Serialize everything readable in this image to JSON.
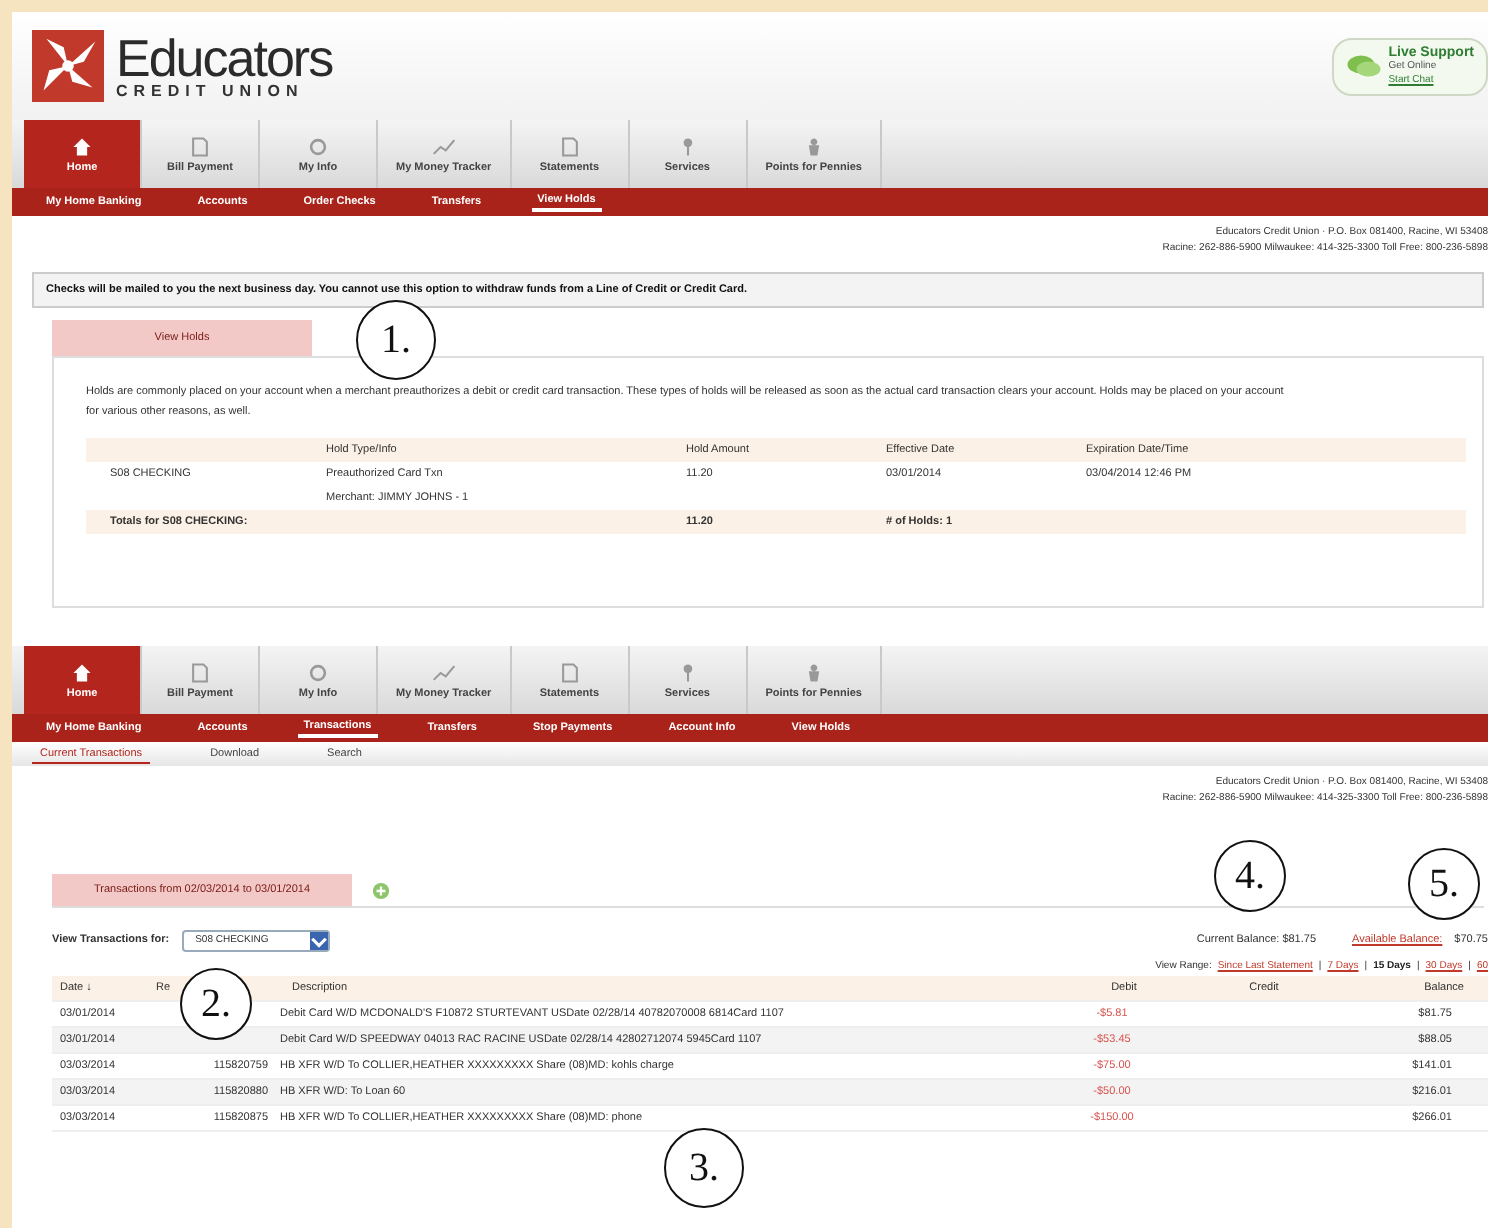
{
  "header": {
    "logo_name": "Educators",
    "logo_sub": "CREDIT UNION",
    "support_title": "Live Support",
    "support_sub": "Get Online",
    "support_link": "Start Chat"
  },
  "top": {
    "tabs": [
      {
        "label": "Home",
        "selected": true
      },
      {
        "label": "Bill Payment",
        "selected": false
      },
      {
        "label": "My Info",
        "selected": false
      },
      {
        "label": "My Money Tracker",
        "selected": false
      },
      {
        "label": "Statements",
        "selected": false
      },
      {
        "label": "Services",
        "selected": false
      },
      {
        "label": "Points for Pennies",
        "selected": false
      }
    ],
    "subnav": [
      {
        "label": "My Home Banking",
        "selected": false
      },
      {
        "label": "Accounts",
        "selected": false
      },
      {
        "label": "Order Checks",
        "selected": false
      },
      {
        "label": "Transfers",
        "selected": false
      },
      {
        "label": "View Holds",
        "selected": true
      }
    ],
    "address": [
      "Educators Credit Union · P.O. Box 081400, Racine, WI 53408",
      "Racine: 262-886-5900 Milwaukee: 414-325-3300 Toll Free: 800-236-5898"
    ],
    "notice": "Checks will be mailed to you the next business day. You cannot use this option to withdraw funds from a Line of Credit or Credit Card.",
    "panel_tab": "View Holds",
    "intro": "Holds are commonly placed on your account when a merchant preauthorizes a debit or credit card transaction. These types of holds will be released as soon as the actual card transaction clears your account. Holds may be placed on your account for various other reasons, as well.",
    "columns": [
      "Hold Type/Info",
      "Hold Amount",
      "Effective Date",
      "Expiration Date/Time"
    ],
    "rows": [
      {
        "account": "S08 CHECKING",
        "type": "Preauthorized Card Txn",
        "info": "Merchant: JIMMY JOHNS - 1",
        "amount": "11.20",
        "effective": "03/01/2014",
        "expiration": "03/04/2014 12:46 PM"
      }
    ],
    "totals": {
      "label": "Totals for S08 CHECKING:",
      "amount": "11.20",
      "count": "# of Holds: 1"
    }
  },
  "bottom": {
    "tabs": [
      {
        "label": "Home",
        "selected": true
      },
      {
        "label": "Bill Payment",
        "selected": false
      },
      {
        "label": "My Info",
        "selected": false
      },
      {
        "label": "My Money Tracker",
        "selected": false
      },
      {
        "label": "Statements",
        "selected": false
      },
      {
        "label": "Services",
        "selected": false
      },
      {
        "label": "Points for Pennies",
        "selected": false
      }
    ],
    "subnav": [
      {
        "label": "My Home Banking",
        "selected": false
      },
      {
        "label": "Accounts",
        "selected": false
      },
      {
        "label": "Transactions",
        "selected": true
      },
      {
        "label": "Transfers",
        "selected": false
      },
      {
        "label": "Stop Payments",
        "selected": false
      },
      {
        "label": "Account Info",
        "selected": false
      },
      {
        "label": "View Holds",
        "selected": false
      }
    ],
    "subtabs": [
      {
        "label": "Current Transactions",
        "selected": true
      },
      {
        "label": "Download",
        "selected": false
      },
      {
        "label": "Search",
        "selected": false
      }
    ],
    "address": [
      "Educators Credit Union · P.O. Box 081400, Racine, WI 53408",
      "Racine: 262-886-5900 Milwaukee: 414-325-3300 Toll Free: 800-236-5898"
    ],
    "panel_tab": "Transactions from 02/03/2014 to 03/01/2014",
    "filter_label": "View Transactions for:",
    "account": "S08 CHECKING",
    "current_balance": "Current Balance: $81.75",
    "available_label": "Available Balance:",
    "available_value": "$70.75",
    "range_label": "View Range:",
    "range_separator": "|",
    "ranges": [
      {
        "label": "Since Last Statement",
        "selected": false
      },
      {
        "label": "7 Days",
        "selected": false
      },
      {
        "label": "15 Days",
        "selected": true
      },
      {
        "label": "30 Days",
        "selected": false
      },
      {
        "label": "60",
        "selected": false
      }
    ],
    "columns": [
      "Date ↓",
      "Re",
      "Description",
      "Debit",
      "Credit",
      "Balance"
    ],
    "rows": [
      {
        "date": "03/01/2014",
        "ref": "",
        "desc": "Debit Card W/D MCDONALD'S F10872 STURTEVANT USDate 02/28/14 40782070008 6814Card 1107",
        "debit": "-$5.81",
        "credit": "",
        "balance": "$81.75"
      },
      {
        "date": "03/01/2014",
        "ref": "",
        "desc": "Debit Card W/D SPEEDWAY 04013 RAC RACINE USDate 02/28/14 42802712074 5945Card 1107",
        "debit": "-$53.45",
        "credit": "",
        "balance": "$88.05"
      },
      {
        "date": "03/03/2014",
        "ref": "115820759",
        "desc": "HB XFR W/D To COLLIER,HEATHER XXXXXXXXX Share (08)MD: kohls charge",
        "debit": "-$75.00",
        "credit": "",
        "balance": "$141.01"
      },
      {
        "date": "03/03/2014",
        "ref": "115820880",
        "desc": "HB XFR W/D: To Loan 60",
        "debit": "-$50.00",
        "credit": "",
        "balance": "$216.01"
      },
      {
        "date": "03/03/2014",
        "ref": "115820875",
        "desc": "HB XFR W/D To COLLIER,HEATHER XXXXXXXXX Share (08)MD: phone",
        "debit": "-$150.00",
        "credit": "",
        "balance": "$266.01"
      }
    ]
  },
  "callouts": [
    "1.",
    "2.",
    "3.",
    "4.",
    "5."
  ]
}
